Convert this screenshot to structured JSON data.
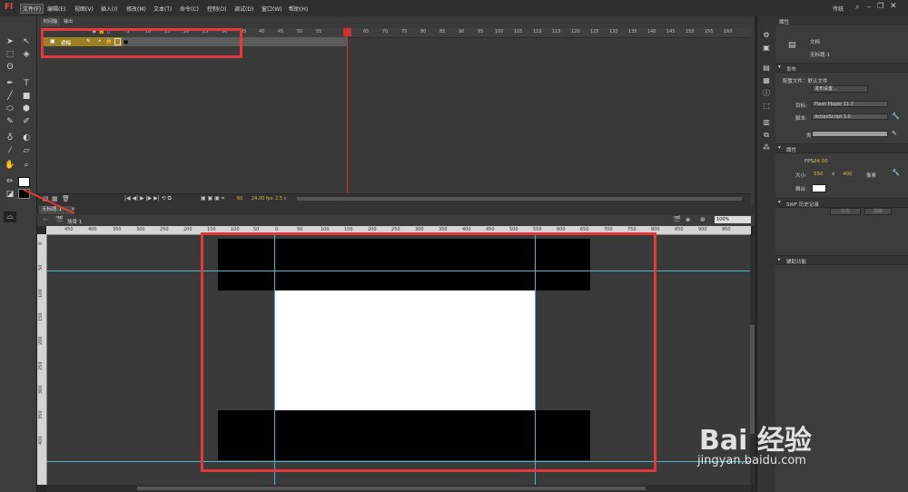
{
  "app": {
    "logo": "Fl",
    "workspace": "传统"
  },
  "menu": [
    "文件(F)",
    "编辑(E)",
    "视图(V)",
    "插入(I)",
    "修改(M)",
    "文本(T)",
    "命令(C)",
    "控制(O)",
    "调试(D)",
    "窗口(W)",
    "帮助(H)"
  ],
  "timeline": {
    "tabs": [
      "时间轴",
      "输出"
    ],
    "frame_numbers": [
      "5",
      "10",
      "15",
      "20",
      "25",
      "30",
      "35",
      "40",
      "45",
      "50",
      "55",
      "60",
      "65",
      "70",
      "75",
      "80",
      "85",
      "90",
      "95",
      "100",
      "105",
      "110",
      "115",
      "120",
      "125",
      "130",
      "135",
      "140",
      "145",
      "150",
      "155",
      "160"
    ],
    "layer_name": "遮幅",
    "status": {
      "frame": "60",
      "fps": "24.00 fps",
      "time": "2.5 s"
    }
  },
  "document": {
    "tab": "无标题-1*",
    "scene": "场景 1",
    "zoom": "100%"
  },
  "ruler": {
    "h": [
      "450",
      "400",
      "350",
      "300",
      "250",
      "200",
      "150",
      "100",
      "50",
      "0",
      "50",
      "100",
      "150",
      "200",
      "250",
      "300",
      "350",
      "400",
      "450",
      "500",
      "550",
      "600",
      "650",
      "700",
      "750",
      "800",
      "850",
      "900",
      "950"
    ],
    "v": [
      "0",
      "50",
      "100",
      "150",
      "200",
      "250",
      "300",
      "350",
      "400"
    ]
  },
  "properties": {
    "title": "属性",
    "doc_type": "文档",
    "doc_name": "无标题-1",
    "publish": {
      "header": "发布",
      "config_label": "配置文件：默认文件",
      "settings_button": "发布设置...",
      "target_label": "目标:",
      "target": "Flash Player 11.7",
      "script_label": "脚本:",
      "script": "ActionScript 3.0",
      "class_label": "类:"
    },
    "props": {
      "header": "属性",
      "fps_label": "FPS:",
      "fps": "24.00",
      "size_label": "大小:",
      "width": "550",
      "x": "x",
      "height": "400",
      "unit": "像素",
      "stage_label": "舞台:"
    },
    "swf_history": {
      "header": "SWF 历史记录",
      "log": "日志",
      "clear": "清除"
    },
    "accessibility": {
      "header": "辅助功能"
    }
  },
  "watermark": {
    "main": "Bai 经验",
    "url": "jingyan.baidu.com"
  },
  "colors": {
    "accent_red": "#e3383d",
    "guide": "#4fb5c8",
    "layer": "#9a8022",
    "playhead": "#c83232"
  }
}
